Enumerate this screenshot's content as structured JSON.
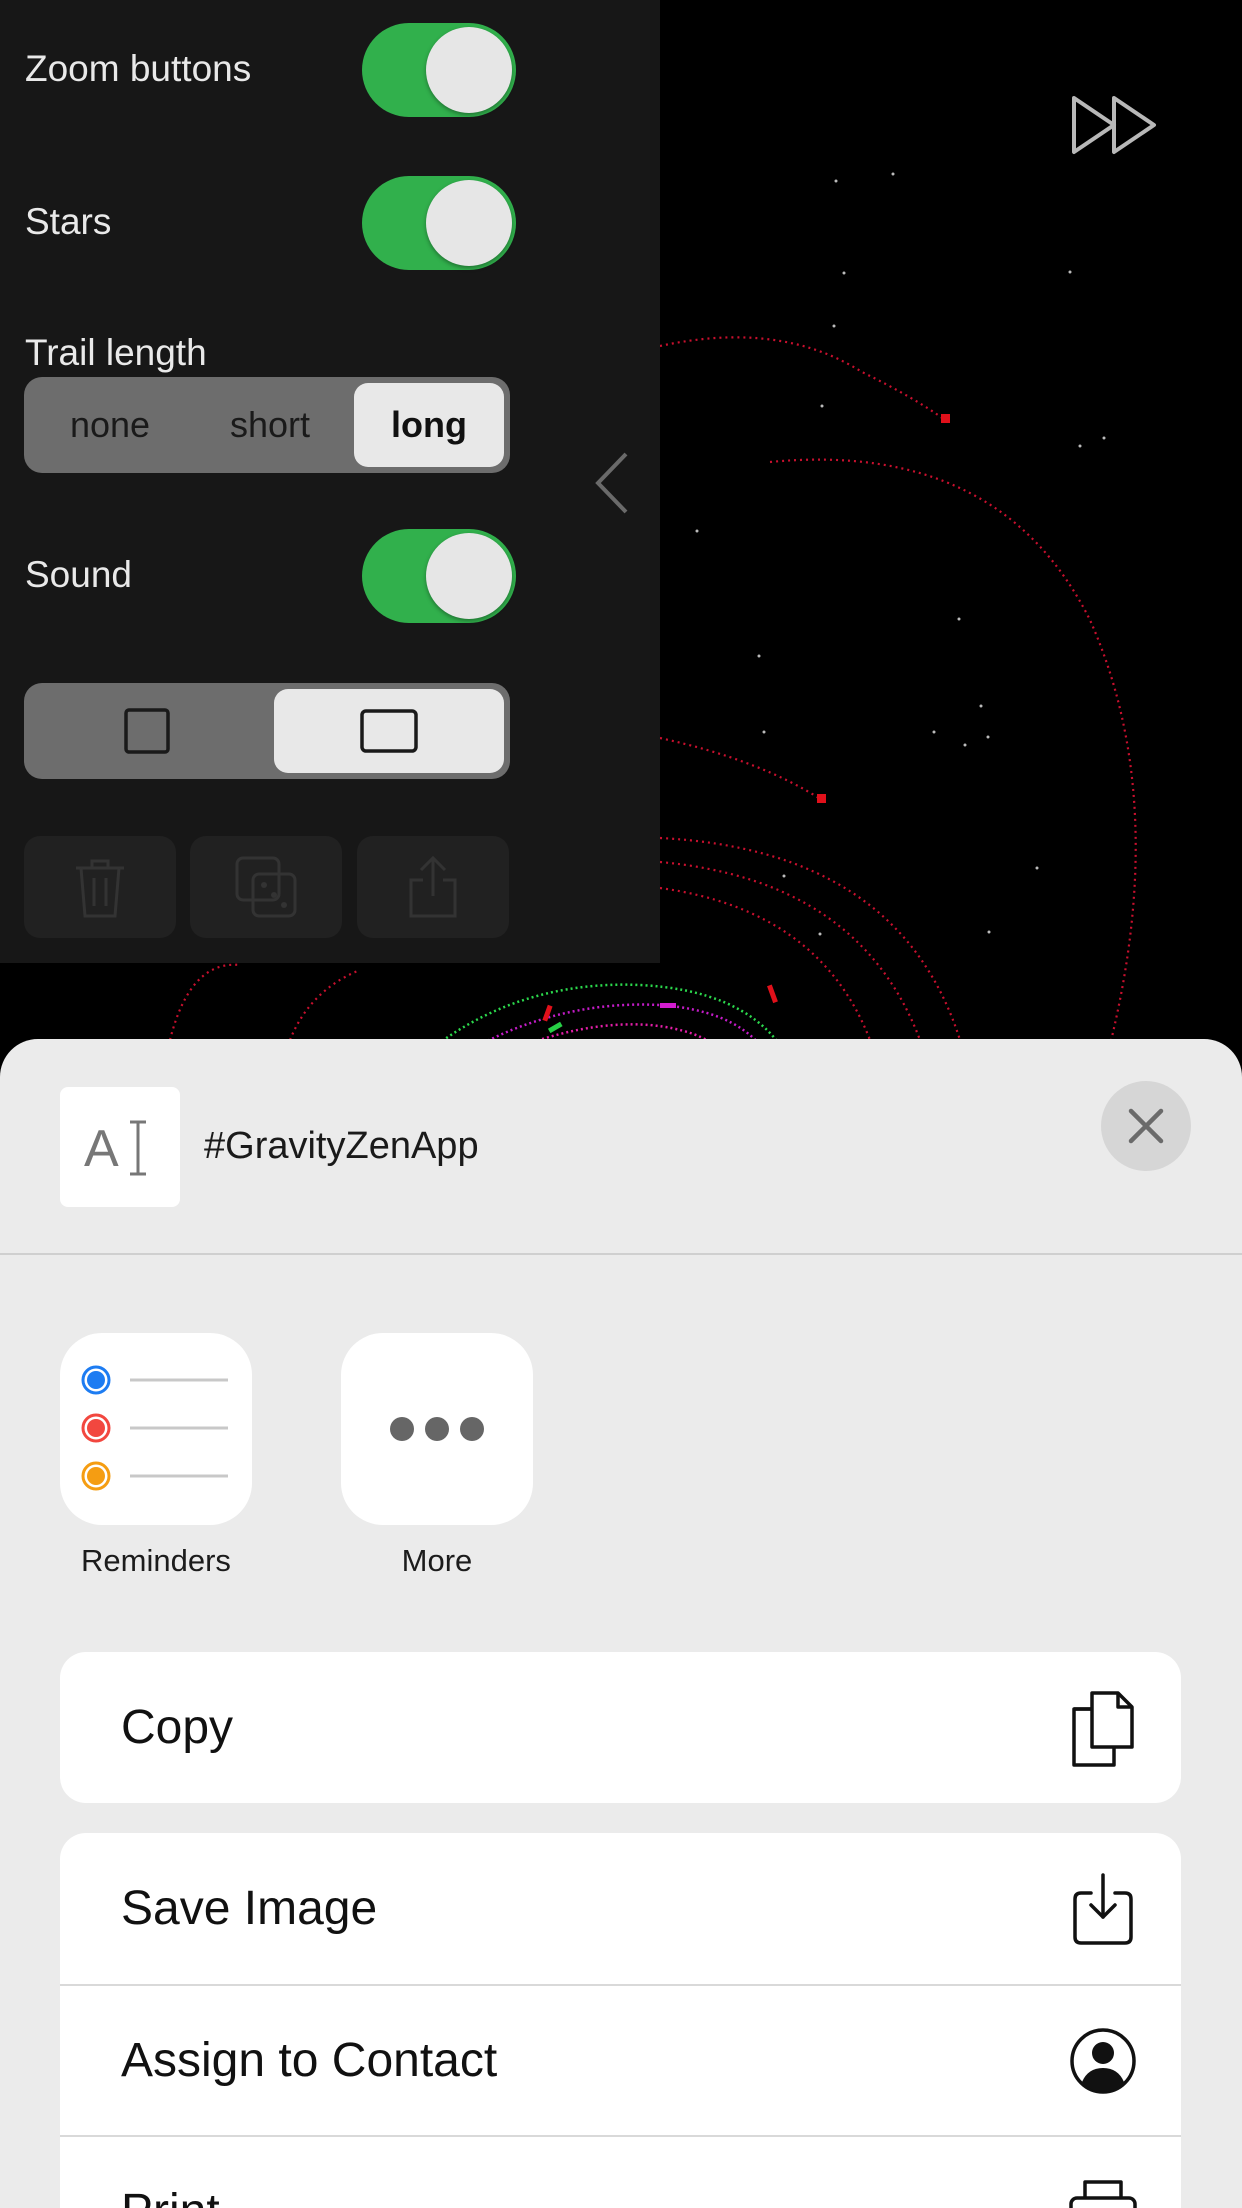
{
  "settings_panel": {
    "zoom_buttons": {
      "label": "Zoom buttons",
      "on": true
    },
    "stars": {
      "label": "Stars",
      "on": true
    },
    "trail_length": {
      "label": "Trail length",
      "options": [
        "none",
        "short",
        "long"
      ],
      "selected": "long"
    },
    "sound": {
      "label": "Sound",
      "on": true
    },
    "aspect_options": [
      "square-icon",
      "wide-rectangle-icon"
    ],
    "aspect_selected": "wide-rectangle-icon",
    "bottom_buttons": [
      "trash-icon",
      "dice-icon",
      "share-icon"
    ]
  },
  "share_sheet": {
    "title": "#GravityZenApp",
    "apps": [
      {
        "label": "Reminders",
        "icon": "reminders-icon"
      },
      {
        "label": "More",
        "icon": "more-icon"
      }
    ],
    "actions": {
      "copy": "Copy",
      "save_image": "Save Image",
      "assign_to_contact": "Assign to Contact",
      "print": "Print"
    }
  },
  "colors": {
    "toggle_on": "#31b04c",
    "orbit": "#c8102e",
    "reminders_blue": "#1d7cf2",
    "reminders_red": "#f2473f",
    "reminders_orange": "#f59d12"
  }
}
